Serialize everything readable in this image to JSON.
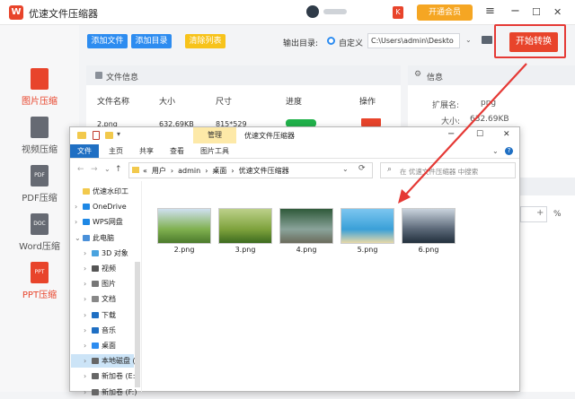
{
  "app": {
    "title": "优速文件压缩器",
    "vip_label": "开通会员",
    "window_controls": [
      "−",
      "☐",
      "✕"
    ]
  },
  "sidebar": {
    "items": [
      {
        "label": "图片压缩",
        "icon": "image-file-icon",
        "color": "#e8442b",
        "active": true
      },
      {
        "label": "视频压缩",
        "icon": "video-file-icon",
        "color": "#666a73",
        "active": false
      },
      {
        "label": "PDF压缩",
        "icon": "pdf-file-icon",
        "color": "#666a73",
        "active": false
      },
      {
        "label": "Word压缩",
        "icon": "doc-file-icon",
        "color": "#666a73",
        "active": false
      },
      {
        "label": "PPT压缩",
        "icon": "ppt-file-icon",
        "color": "#e8442b",
        "active": false
      }
    ],
    "icon_texts": [
      "",
      "",
      "PDF",
      "DOC",
      "PPT"
    ]
  },
  "toolbar": {
    "add_file": "添加文件",
    "add_folder": "添加目录",
    "clear_list": "清除列表",
    "output_label": "输出目录:",
    "custom_label": "自定义",
    "output_path": "C:\\Users\\admin\\Deskto",
    "start_button": "开始转换"
  },
  "file_panel": {
    "title": "文件信息",
    "columns": [
      "文件名称",
      "大小",
      "尺寸",
      "进度",
      "操作"
    ],
    "row": {
      "name": "2.png",
      "size": "632.69KB",
      "dims": "815*529"
    }
  },
  "info_panel": {
    "title": "信息",
    "ext_label": "扩展名:",
    "ext_value": "png",
    "size_label": "大小:",
    "size_value": "632.69KB",
    "percent": "%"
  },
  "explorer": {
    "title": "优速文件压缩器",
    "manage_tab": "管理",
    "tabs": [
      "文件",
      "主页",
      "共享",
      "查看",
      "图片工具"
    ],
    "breadcrumb": [
      "«",
      "用户",
      "›",
      "admin",
      "›",
      "桌面",
      "›",
      "优速文件压缩器"
    ],
    "search_placeholder": "在 优速文件压缩器 中搜索",
    "nav": [
      {
        "label": "优速水印工",
        "icon": "folder-icon",
        "expand": ""
      },
      {
        "label": "OneDrive",
        "icon": "cloud-icon",
        "expand": "›"
      },
      {
        "label": "WPS网盘",
        "icon": "wps-cloud-icon",
        "expand": "›"
      },
      {
        "label": "此电脑",
        "icon": "computer-icon",
        "expand": "⌄"
      },
      {
        "label": "3D 对象",
        "icon": "cube-icon",
        "expand": "›"
      },
      {
        "label": "视频",
        "icon": "video-icon",
        "expand": "›"
      },
      {
        "label": "图片",
        "icon": "picture-icon",
        "expand": "›"
      },
      {
        "label": "文档",
        "icon": "document-icon",
        "expand": "›"
      },
      {
        "label": "下载",
        "icon": "download-icon",
        "expand": "›"
      },
      {
        "label": "音乐",
        "icon": "music-icon",
        "expand": "›"
      },
      {
        "label": "桌面",
        "icon": "desktop-icon",
        "expand": "›"
      },
      {
        "label": "本地磁盘 (C",
        "icon": "disk-icon",
        "expand": "›"
      },
      {
        "label": "新加卷 (E:)",
        "icon": "disk-icon",
        "expand": "›"
      },
      {
        "label": "新加卷 (F:)",
        "icon": "disk-icon",
        "expand": "›"
      }
    ],
    "files": [
      {
        "name": "2.png",
        "colors": [
          "#cfe0ef",
          "#7fb04f",
          "#4c7a2c"
        ]
      },
      {
        "name": "3.png",
        "colors": [
          "#bcd08a",
          "#7ea23c",
          "#3d6b1f"
        ]
      },
      {
        "name": "4.png",
        "colors": [
          "#2f5a3a",
          "#8aa39a",
          "#6b6b5c"
        ]
      },
      {
        "name": "5.png",
        "colors": [
          "#7cc6f0",
          "#3aa0d8",
          "#e8d9a8"
        ]
      },
      {
        "name": "6.png",
        "colors": [
          "#c9d3dd",
          "#5a6777",
          "#22303d"
        ]
      }
    ]
  },
  "colors": {
    "accent": "#e8442b",
    "blue": "#2d8cf0",
    "yellow": "#f7c31b",
    "arrow": "#e53935"
  }
}
